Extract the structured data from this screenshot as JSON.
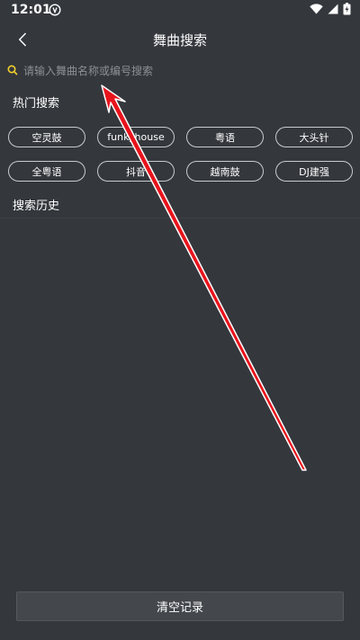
{
  "status_bar": {
    "time": "12:01"
  },
  "header": {
    "title": "舞曲搜索"
  },
  "search": {
    "placeholder": "请输入舞曲名称或编号搜索"
  },
  "hot_search": {
    "title": "热门搜索",
    "tags": [
      "空灵鼓",
      "funkyhouse",
      "粤语",
      "大头针",
      "全粤语",
      "抖音",
      "越南鼓",
      "DJ建强"
    ]
  },
  "history": {
    "title": "搜索历史"
  },
  "footer": {
    "clear_label": "清空记录"
  },
  "colors": {
    "background": "#34373c",
    "accent_search_icon": "#f2d12e",
    "annotation_arrow": "#e8141c"
  }
}
